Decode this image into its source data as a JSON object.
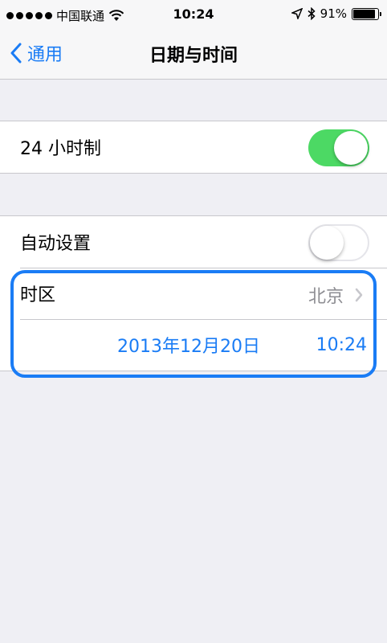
{
  "status": {
    "carrier": "中国联通",
    "time": "10:24",
    "battery": "91%",
    "battery_level": 0.91
  },
  "nav": {
    "back_label": "通用",
    "title": "日期与时间"
  },
  "settings": {
    "hour24": {
      "label": "24 小时制",
      "on": true
    },
    "auto_set": {
      "label": "自动设置",
      "on": false
    },
    "timezone": {
      "label": "时区",
      "value": "北京"
    },
    "date": "2013年12月20日",
    "time": "10:24"
  },
  "colors": {
    "accent": "#1a7cf5",
    "switch_on": "#4cd964",
    "background": "#efeff4"
  },
  "icons": [
    "signal-dots-icon",
    "wifi-icon",
    "location-arrow-icon",
    "bluetooth-icon",
    "battery-icon",
    "chevron-left-icon",
    "chevron-right-icon"
  ]
}
